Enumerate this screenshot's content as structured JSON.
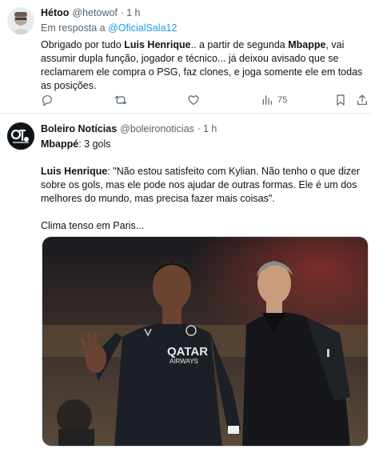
{
  "tweet1": {
    "name": "Hétoo",
    "handle": "@hetowof",
    "separator": "·",
    "time": "1 h",
    "reply_prefix": "Em resposta a",
    "reply_mention": "@OficialSala12",
    "text": {
      "p1": "Obrigado por tudo ",
      "b1": "Luis Henrique",
      "p2": ".. a partir de segunda ",
      "b2": "Mbappe",
      "p3": ", vai assumir dupla função, jogador e técnico... já deixou avisado que se reclamarem ele compra o PSG, faz clones, e joga somente ele em todas as posições."
    },
    "views": "75",
    "icons": [
      "reply-icon",
      "retweet-icon",
      "like-icon",
      "views-icon",
      "bookmark-icon",
      "share-icon"
    ]
  },
  "tweet2": {
    "name": "Boleiro Notícias",
    "handle": "@boleironoticias",
    "separator": "·",
    "time": "1 h",
    "line1_bold": "Mbappé",
    "line1_rest": ": 3 gols",
    "quote_bold": "Luis Henrique",
    "quote_rest": ": \"Não estou satisfeito com Kylian. Não tenho o que dizer sobre os gols, mas ele pode nos ajudar de outras formas. Ele é um dos melhores do mundo, mas precisa fazer mais coisas\".",
    "closing": "Clima tenso em Paris...",
    "photo": {
      "shirt_line1": "QATAR",
      "shirt_line2": "AIRWAYS",
      "colors": {
        "shirt": "#1c1f26",
        "background": "#3a2d2a",
        "jacket": "#15171b"
      }
    }
  },
  "colors": {
    "accent": "#1d9bf0",
    "secondary_text": "#536471",
    "divider": "#e6ecf0"
  }
}
